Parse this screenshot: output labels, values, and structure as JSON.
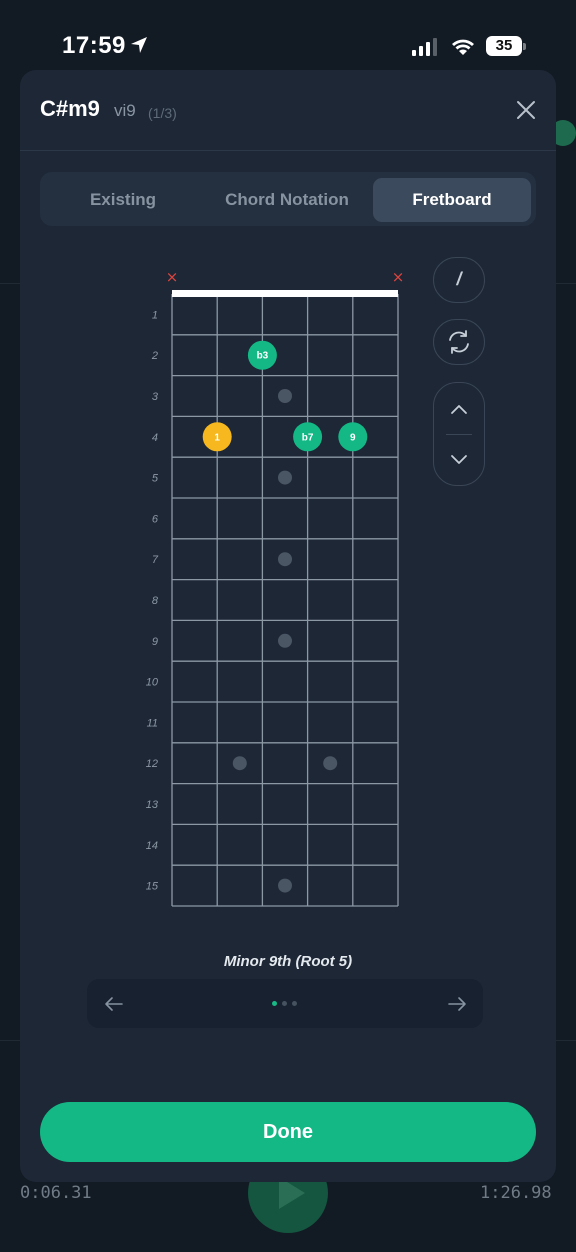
{
  "status_bar": {
    "time": "17:59",
    "battery": "35"
  },
  "background": {
    "elapsed": "0:06.31",
    "total": "1:26.98"
  },
  "modal": {
    "chord_name": "C#m9",
    "degree": "vi9",
    "voicing_count": "(1/3)"
  },
  "tabs": [
    {
      "label": "Existing",
      "active": false
    },
    {
      "label": "Chord Notation",
      "active": false
    },
    {
      "label": "Fretboard",
      "active": true
    }
  ],
  "fretboard": {
    "strings": 6,
    "frets": 15,
    "fret_numbers": [
      "1",
      "2",
      "3",
      "4",
      "5",
      "6",
      "7",
      "8",
      "9",
      "10",
      "11",
      "12",
      "13",
      "14",
      "15"
    ],
    "muted_strings": [
      1,
      6
    ],
    "mute_symbol": "×",
    "inlay_frets": [
      3,
      5,
      7,
      9,
      12,
      15
    ],
    "notes": [
      {
        "string": 2,
        "fret": 4,
        "label": "1",
        "type": "root"
      },
      {
        "string": 3,
        "fret": 2,
        "label": "b3",
        "type": "interval"
      },
      {
        "string": 4,
        "fret": 4,
        "label": "b7",
        "type": "interval"
      },
      {
        "string": 5,
        "fret": 4,
        "label": "9",
        "type": "interval"
      }
    ],
    "colors": {
      "root": "#f6b81e",
      "interval": "#14b885",
      "grid": "#8d98a5",
      "nut": "#ffffff",
      "inlay": "#4b5665",
      "mute": "#e0443e"
    }
  },
  "controls": {
    "slash_label": "/"
  },
  "voicing": {
    "name": "Minor 9th (Root 5)",
    "pages": 3,
    "current_page": 1
  },
  "done_label": "Done"
}
